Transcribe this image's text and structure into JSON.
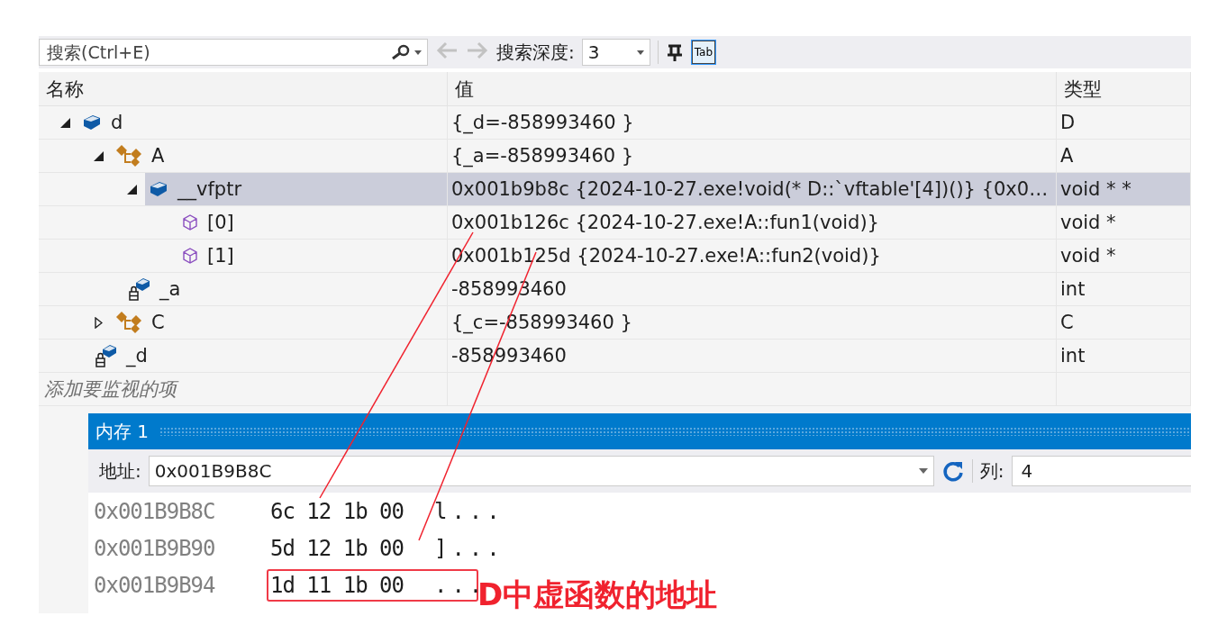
{
  "toolbar": {
    "search": {
      "placeholder": "搜索(Ctrl+E)"
    },
    "back_disabled": true,
    "forward_disabled": true,
    "depth_label": "搜索深度:",
    "depth_value": "3",
    "tab_toggle": {
      "label": "Tab",
      "selected": true
    }
  },
  "watch": {
    "columns": [
      "名称",
      "值",
      "类型"
    ],
    "rows": [
      {
        "name": "d",
        "value": "{_d=-858993460 }",
        "type": "D",
        "kind": "object",
        "expanded": true,
        "selected": false,
        "children": [
          {
            "name": "A",
            "value": "{_a=-858993460 }",
            "type": "A",
            "kind": "base",
            "expanded": true,
            "selected": false,
            "children": [
              {
                "name": "__vfptr",
                "value": "0x001b9b8c {2024-10-27.exe!void(* D::`vftable'[4])()} {0x0…",
                "type": "void * *",
                "kind": "object",
                "expanded": true,
                "selected": true,
                "children": [
                  {
                    "name": "[0]",
                    "value": "0x001b126c {2024-10-27.exe!A::fun1(void)}",
                    "type": "void *",
                    "kind": "pointer",
                    "selected": false
                  },
                  {
                    "name": "[1]",
                    "value": "0x001b125d {2024-10-27.exe!A::fun2(void)}",
                    "type": "void *",
                    "kind": "pointer",
                    "selected": false
                  }
                ]
              },
              {
                "name": "_a",
                "value": "-858993460",
                "type": "int",
                "kind": "private",
                "selected": false
              }
            ]
          },
          {
            "name": "C",
            "value": "{_c=-858993460 }",
            "type": "C",
            "kind": "base",
            "expanded": false,
            "selected": false
          },
          {
            "name": "_d",
            "value": "-858993460",
            "type": "int",
            "kind": "private",
            "selected": false
          }
        ]
      }
    ],
    "add_placeholder": "添加要监视的项"
  },
  "memory": {
    "title": "内存 1",
    "address_label": "地址:",
    "address": "0x001B9B8C",
    "columns_label": "列:",
    "columns_value": "4",
    "rows": [
      {
        "address": "0x001B9B8C",
        "bytes": "6c 12 1b 00",
        "chars": "l...",
        "boxed": false
      },
      {
        "address": "0x001B9B90",
        "bytes": "5d 12 1b 00",
        "chars": "]...",
        "boxed": false
      },
      {
        "address": "0x001B9B94",
        "bytes": "1d 11 1b 00",
        "chars": "...",
        "boxed": true
      }
    ]
  },
  "annotation": {
    "label": "D中虚函数的地址"
  }
}
